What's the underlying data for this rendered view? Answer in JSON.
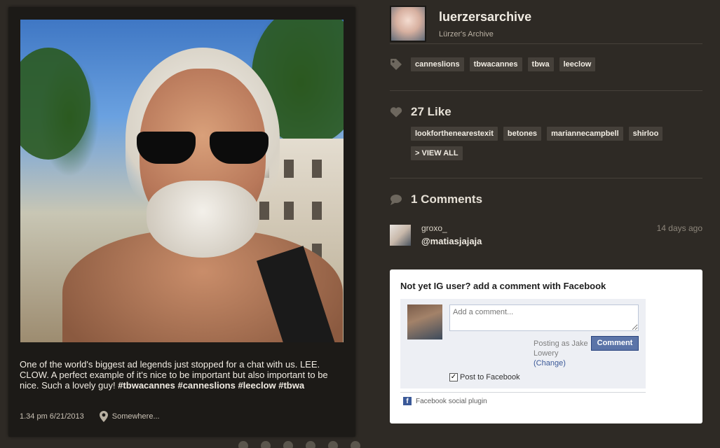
{
  "post": {
    "caption_text": "One of the world's biggest ad legends just stopped for a chat with us. LEE. CLOW. A perfect example of it's nice to be important but also important to be nice. Such a lovely guy!",
    "caption_tags": "#tbwacannes #canneslions #leeclow #tbwa",
    "timestamp": "1.34 pm 6/21/2013",
    "location": "Somewhere..."
  },
  "profile": {
    "username": "luerzersarchive",
    "fullname": "Lürzer's Archive"
  },
  "tags": [
    "canneslions",
    "tbwacannes",
    "tbwa",
    "leeclow"
  ],
  "likes": {
    "title": "27 Like",
    "users": [
      "lookforthenearestexit",
      "betones",
      "mariannecampbell",
      "shirloo"
    ],
    "view_all": "> VIEW ALL"
  },
  "comments": {
    "title": "1 Comments",
    "items": [
      {
        "user": "groxo_",
        "text": "@matiasjajaja",
        "time": "14 days ago"
      }
    ]
  },
  "facebook": {
    "title": "Not yet IG user? add a comment with Facebook",
    "placeholder": "Add a comment...",
    "posting_as": "Posting as Jake Lowery",
    "change": "(Change)",
    "comment_button": "Comment",
    "post_to_facebook": "Post to Facebook",
    "plugin_label": "Facebook social plugin"
  }
}
